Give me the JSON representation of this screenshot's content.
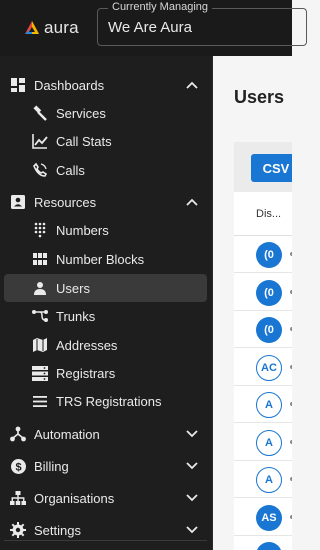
{
  "app": {
    "logo_text": "aura"
  },
  "managing": {
    "legend": "Currently Managing",
    "value": "We Are Aura"
  },
  "sidebar": {
    "sections": [
      {
        "label": "Dashboards",
        "icon": "dashboard-icon",
        "expanded": true,
        "items": [
          {
            "label": "Services",
            "icon": "hammer-icon"
          },
          {
            "label": "Call Stats",
            "icon": "chart-line-icon"
          },
          {
            "label": "Calls",
            "icon": "phone-icon"
          }
        ]
      },
      {
        "label": "Resources",
        "icon": "contact-card-icon",
        "expanded": true,
        "items": [
          {
            "label": "Numbers",
            "icon": "dialpad-icon"
          },
          {
            "label": "Number Blocks",
            "icon": "grid-icon"
          },
          {
            "label": "Users",
            "icon": "person-icon",
            "active": true
          },
          {
            "label": "Trunks",
            "icon": "route-icon"
          },
          {
            "label": "Addresses",
            "icon": "map-icon"
          },
          {
            "label": "Registrars",
            "icon": "server-icon"
          },
          {
            "label": "TRS Registrations",
            "icon": "menu-icon"
          }
        ]
      },
      {
        "label": "Automation",
        "icon": "automation-icon",
        "expanded": false
      },
      {
        "label": "Billing",
        "icon": "dollar-icon",
        "expanded": false
      },
      {
        "label": "Organisations",
        "icon": "org-chart-icon",
        "expanded": false
      },
      {
        "label": "Settings",
        "icon": "gear-icon",
        "expanded": false
      }
    ]
  },
  "main": {
    "title": "Users",
    "csv_label": "CSV",
    "column_header": "Dis...",
    "rows": [
      {
        "avatar": "(0",
        "style": "filled"
      },
      {
        "avatar": "(0",
        "style": "filled"
      },
      {
        "avatar": "(0",
        "style": "filled"
      },
      {
        "avatar": "AC",
        "style": "outline"
      },
      {
        "avatar": "A",
        "style": "outline"
      },
      {
        "avatar": "A",
        "style": "outline"
      },
      {
        "avatar": "A",
        "style": "outline"
      },
      {
        "avatar": "AS",
        "style": "filled"
      },
      {
        "avatar": "",
        "style": "filled"
      }
    ]
  },
  "colors": {
    "accent": "#1976d2",
    "sidebar_bg": "#1e1e1e",
    "active_item_bg": "#3a3a3a"
  }
}
